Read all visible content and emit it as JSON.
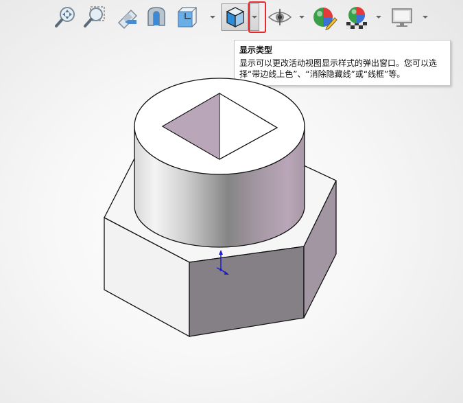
{
  "toolbar": {
    "buttons": [
      {
        "id": "zoom-to-fit",
        "icon": "zoom-to-fit-icon"
      },
      {
        "id": "zoom-to-area",
        "icon": "zoom-to-area-icon"
      },
      {
        "id": "previous-view",
        "icon": "previous-view-icon"
      },
      {
        "id": "section-view",
        "icon": "section-view-icon"
      },
      {
        "id": "view-orientation",
        "icon": "view-orientation-icon"
      },
      {
        "id": "display-style",
        "icon": "display-style-icon"
      },
      {
        "id": "hide-show-items",
        "icon": "eye-icon"
      },
      {
        "id": "edit-appearance",
        "icon": "edit-appearance-icon"
      },
      {
        "id": "apply-scene",
        "icon": "apply-scene-icon"
      },
      {
        "id": "view-settings",
        "icon": "monitor-icon"
      }
    ]
  },
  "tooltip": {
    "title": "显示类型",
    "body": "显示可以更改活动视图显示样式的弹出窗口。您可以选择“带边线上色”、“消除隐藏线”或“线框”等。"
  },
  "colors": {
    "highlight": "#e8272a",
    "face_purple": "#b9a6b8",
    "face_dark": "#858085",
    "triad_blue": "#1a1acc"
  }
}
